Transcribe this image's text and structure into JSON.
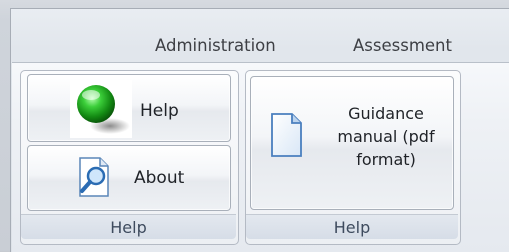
{
  "tabs": {
    "administration": "Administration",
    "assessment": "Assessment"
  },
  "help_group": {
    "help_button_label": "Help",
    "about_button_label": "About",
    "caption": "Help",
    "help_icon": "green-orb-icon",
    "about_icon": "document-magnifier-icon"
  },
  "guidance_group": {
    "guidance_button_label": "Guidance manual (pdf format)",
    "caption": "Help",
    "guidance_icon": "document-icon"
  },
  "colors": {
    "orb_green": "#1f9e1f",
    "doc_blue": "#4a90d9"
  }
}
